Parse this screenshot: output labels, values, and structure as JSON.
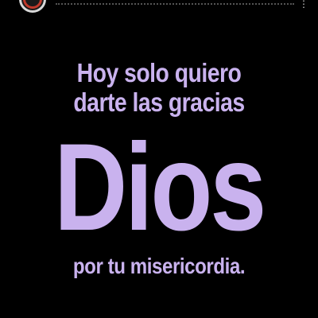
{
  "post": {
    "line1": "Hoy solo quiero",
    "line2": "darte las gracias",
    "big_word": "Dios",
    "line3": "por tu misericordia."
  },
  "colors": {
    "background": "#000000",
    "text": "#c9b2ee",
    "avatar_ring": "#c0392b"
  },
  "icons": {
    "avatar": "profile-avatar",
    "more": "more-options-icon"
  }
}
